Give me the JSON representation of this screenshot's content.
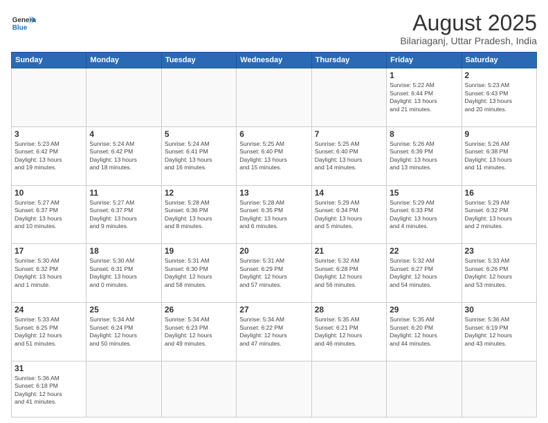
{
  "header": {
    "logo_general": "General",
    "logo_blue": "Blue",
    "month_title": "August 2025",
    "location": "Bilariaganj, Uttar Pradesh, India"
  },
  "weekdays": [
    "Sunday",
    "Monday",
    "Tuesday",
    "Wednesday",
    "Thursday",
    "Friday",
    "Saturday"
  ],
  "weeks": [
    [
      {
        "day": "",
        "info": ""
      },
      {
        "day": "",
        "info": ""
      },
      {
        "day": "",
        "info": ""
      },
      {
        "day": "",
        "info": ""
      },
      {
        "day": "",
        "info": ""
      },
      {
        "day": "1",
        "info": "Sunrise: 5:22 AM\nSunset: 6:44 PM\nDaylight: 13 hours\nand 21 minutes."
      },
      {
        "day": "2",
        "info": "Sunrise: 5:23 AM\nSunset: 6:43 PM\nDaylight: 13 hours\nand 20 minutes."
      }
    ],
    [
      {
        "day": "3",
        "info": "Sunrise: 5:23 AM\nSunset: 6:42 PM\nDaylight: 13 hours\nand 19 minutes."
      },
      {
        "day": "4",
        "info": "Sunrise: 5:24 AM\nSunset: 6:42 PM\nDaylight: 13 hours\nand 18 minutes."
      },
      {
        "day": "5",
        "info": "Sunrise: 5:24 AM\nSunset: 6:41 PM\nDaylight: 13 hours\nand 16 minutes."
      },
      {
        "day": "6",
        "info": "Sunrise: 5:25 AM\nSunset: 6:40 PM\nDaylight: 13 hours\nand 15 minutes."
      },
      {
        "day": "7",
        "info": "Sunrise: 5:25 AM\nSunset: 6:40 PM\nDaylight: 13 hours\nand 14 minutes."
      },
      {
        "day": "8",
        "info": "Sunrise: 5:26 AM\nSunset: 6:39 PM\nDaylight: 13 hours\nand 13 minutes."
      },
      {
        "day": "9",
        "info": "Sunrise: 5:26 AM\nSunset: 6:38 PM\nDaylight: 13 hours\nand 11 minutes."
      }
    ],
    [
      {
        "day": "10",
        "info": "Sunrise: 5:27 AM\nSunset: 6:37 PM\nDaylight: 13 hours\nand 10 minutes."
      },
      {
        "day": "11",
        "info": "Sunrise: 5:27 AM\nSunset: 6:37 PM\nDaylight: 13 hours\nand 9 minutes."
      },
      {
        "day": "12",
        "info": "Sunrise: 5:28 AM\nSunset: 6:36 PM\nDaylight: 13 hours\nand 8 minutes."
      },
      {
        "day": "13",
        "info": "Sunrise: 5:28 AM\nSunset: 6:35 PM\nDaylight: 13 hours\nand 6 minutes."
      },
      {
        "day": "14",
        "info": "Sunrise: 5:29 AM\nSunset: 6:34 PM\nDaylight: 13 hours\nand 5 minutes."
      },
      {
        "day": "15",
        "info": "Sunrise: 5:29 AM\nSunset: 6:33 PM\nDaylight: 13 hours\nand 4 minutes."
      },
      {
        "day": "16",
        "info": "Sunrise: 5:29 AM\nSunset: 6:32 PM\nDaylight: 13 hours\nand 2 minutes."
      }
    ],
    [
      {
        "day": "17",
        "info": "Sunrise: 5:30 AM\nSunset: 6:32 PM\nDaylight: 13 hours\nand 1 minute."
      },
      {
        "day": "18",
        "info": "Sunrise: 5:30 AM\nSunset: 6:31 PM\nDaylight: 13 hours\nand 0 minutes."
      },
      {
        "day": "19",
        "info": "Sunrise: 5:31 AM\nSunset: 6:30 PM\nDaylight: 12 hours\nand 58 minutes."
      },
      {
        "day": "20",
        "info": "Sunrise: 5:31 AM\nSunset: 6:29 PM\nDaylight: 12 hours\nand 57 minutes."
      },
      {
        "day": "21",
        "info": "Sunrise: 5:32 AM\nSunset: 6:28 PM\nDaylight: 12 hours\nand 56 minutes."
      },
      {
        "day": "22",
        "info": "Sunrise: 5:32 AM\nSunset: 6:27 PM\nDaylight: 12 hours\nand 54 minutes."
      },
      {
        "day": "23",
        "info": "Sunrise: 5:33 AM\nSunset: 6:26 PM\nDaylight: 12 hours\nand 53 minutes."
      }
    ],
    [
      {
        "day": "24",
        "info": "Sunrise: 5:33 AM\nSunset: 6:25 PM\nDaylight: 12 hours\nand 51 minutes."
      },
      {
        "day": "25",
        "info": "Sunrise: 5:34 AM\nSunset: 6:24 PM\nDaylight: 12 hours\nand 50 minutes."
      },
      {
        "day": "26",
        "info": "Sunrise: 5:34 AM\nSunset: 6:23 PM\nDaylight: 12 hours\nand 49 minutes."
      },
      {
        "day": "27",
        "info": "Sunrise: 5:34 AM\nSunset: 6:22 PM\nDaylight: 12 hours\nand 47 minutes."
      },
      {
        "day": "28",
        "info": "Sunrise: 5:35 AM\nSunset: 6:21 PM\nDaylight: 12 hours\nand 46 minutes."
      },
      {
        "day": "29",
        "info": "Sunrise: 5:35 AM\nSunset: 6:20 PM\nDaylight: 12 hours\nand 44 minutes."
      },
      {
        "day": "30",
        "info": "Sunrise: 5:36 AM\nSunset: 6:19 PM\nDaylight: 12 hours\nand 43 minutes."
      }
    ],
    [
      {
        "day": "31",
        "info": "Sunrise: 5:36 AM\nSunset: 6:18 PM\nDaylight: 12 hours\nand 41 minutes."
      },
      {
        "day": "",
        "info": ""
      },
      {
        "day": "",
        "info": ""
      },
      {
        "day": "",
        "info": ""
      },
      {
        "day": "",
        "info": ""
      },
      {
        "day": "",
        "info": ""
      },
      {
        "day": "",
        "info": ""
      }
    ]
  ]
}
